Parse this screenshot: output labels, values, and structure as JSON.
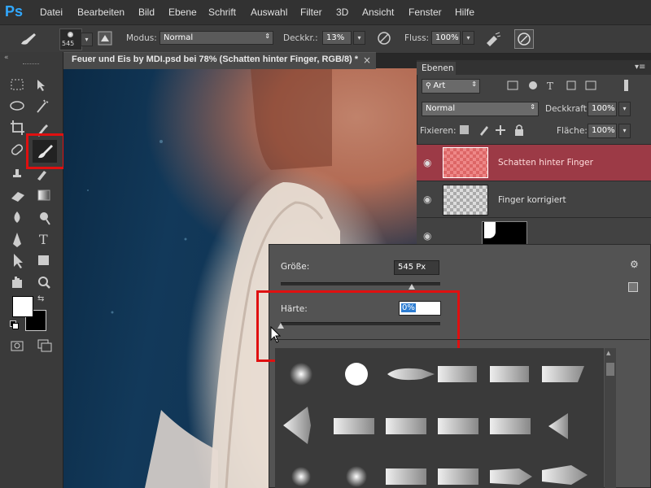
{
  "app": {
    "logo": "Ps"
  },
  "menubar": {
    "items": [
      "Datei",
      "Bearbeiten",
      "Bild",
      "Ebene",
      "Schrift",
      "Auswahl",
      "Filter",
      "3D",
      "Ansicht",
      "Fenster",
      "Hilfe"
    ]
  },
  "options": {
    "brush_size": "545",
    "mode_label": "Modus:",
    "mode_value": "Normal",
    "opacity_label": "Deckkr.:",
    "opacity_value": "13%",
    "flow_label": "Fluss:",
    "flow_value": "100%"
  },
  "document": {
    "tab_title": "Feuer und Eis by MDI.psd bei 78% (Schatten hinter Finger, RGB/8) *",
    "close": "×"
  },
  "layers_panel": {
    "title": "Ebenen",
    "filter_value": "Art",
    "blend_mode": "Normal",
    "opacity_label": "Deckkraft:",
    "opacity_value": "100%",
    "lock_label": "Fixieren:",
    "fill_label": "Fläche:",
    "fill_value": "100%",
    "layers": [
      {
        "name": "Schatten hinter Finger",
        "selected": true
      },
      {
        "name": "Finger korrigiert",
        "selected": false
      }
    ]
  },
  "brush_popup": {
    "size_label": "Größe:",
    "size_value": "545 Px",
    "size_fraction": 0.82,
    "hardness_label": "Härte:",
    "hardness_value": "0%",
    "hardness_fraction": 0.0
  },
  "colors": {
    "highlight": "#e01010",
    "selected_layer": "#9c3a46",
    "ps_blue": "#31a8ff"
  }
}
